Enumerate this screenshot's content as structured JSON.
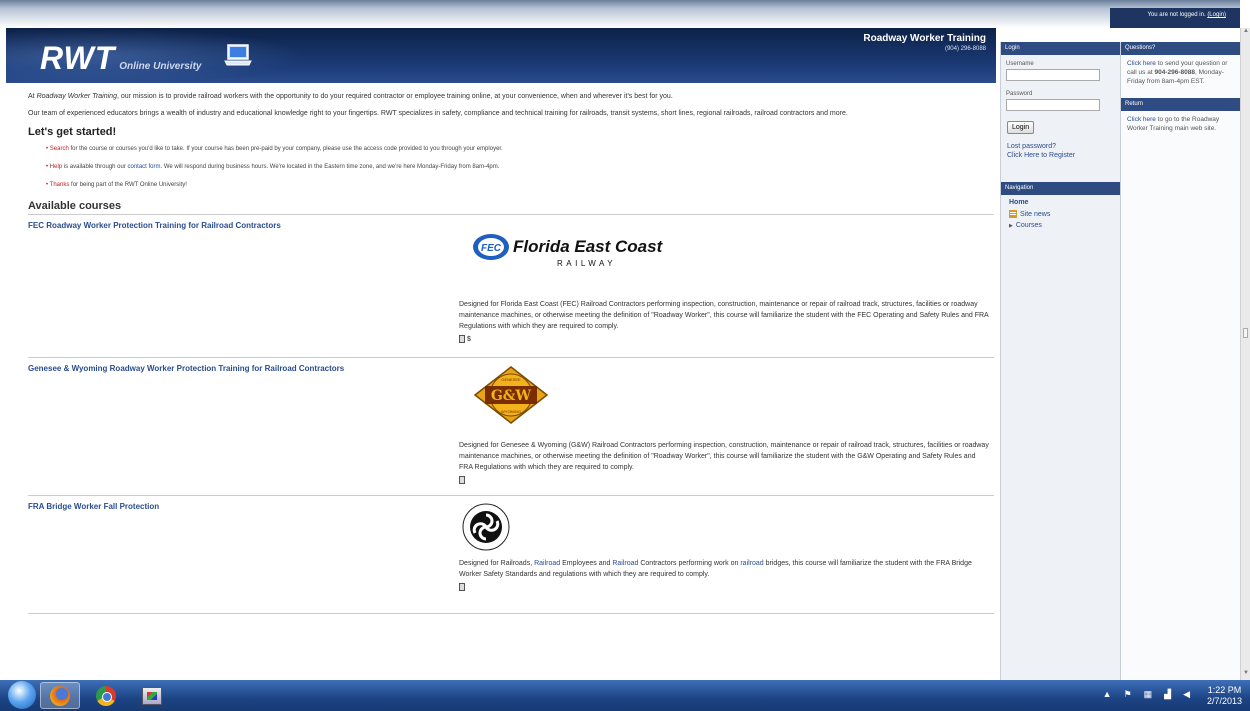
{
  "header": {
    "login_status": "You are not logged in.",
    "login_link": "(Login)",
    "logo_main": "RWT",
    "logo_sub": "Online University",
    "site_name": "Roadway Worker Training",
    "site_phone": "(904) 296-8088"
  },
  "intro": {
    "p1_prefix": "At ",
    "p1_company": "Roadway Worker Training",
    "p1_rest": ", our mission is to provide railroad workers with the opportunity to do your required contractor or employee training online, at your convenience, when and wherever it's best for you.",
    "p2": "Our team of experienced educators brings a wealth of industry and educational knowledge right to your fingertips. RWT specializes in safety, compliance and technical training for railroads, transit systems, short lines, regional railroads, railroad contractors and more."
  },
  "get_started": {
    "heading": "Let's get started!",
    "bullets": [
      {
        "kw": "Search",
        "text": " for the course or courses you'd like to take. If your course has been pre-paid by your company, please use the access code provided to you through your employer."
      },
      {
        "kw": "Help",
        "text_a": " is available through our ",
        "link": "contact form",
        "text_b": ". We will respond during business hours. We're located in the Eastern time zone, and we're here Monday-Friday from 8am-4pm."
      },
      {
        "kw": "Thanks",
        "text": " for being part of the RWT Online University!"
      }
    ]
  },
  "courses": {
    "heading": "Available courses",
    "items": [
      {
        "title": "FEC Roadway Worker Protection Training for Railroad Contractors",
        "logo_text_1": "Florida East Coast",
        "logo_text_2": "RAILWAY",
        "logo_badge": "FEC",
        "description": "Designed for Florida East Coast (FEC) Railroad Contractors performing inspection, construction, maintenance or repair of railroad track, structures, facilities or roadway maintenance machines, or otherwise meeting the definition of \"Roadway Worker\", this course will familiarize the student with the FEC Operating and Safety Rules and FRA Regulations with which they are required to comply.",
        "pay_icon": "$"
      },
      {
        "title": "Genesee & Wyoming Roadway Worker Protection Training for Railroad Contractors",
        "logo_text_1": "G&W",
        "logo_text_top": "GENESEE",
        "logo_text_bottom": "WYOMING",
        "description": "Designed for Genesee & Wyoming (G&W) Railroad Contractors performing inspection, construction, maintenance or repair of railroad track, structures, facilities or roadway maintenance machines, or otherwise meeting the definition of \"Roadway Worker\", this course will familiarize the student with the G&W Operating and Safety Rules and FRA Regulations with which they are required to comply."
      },
      {
        "title": "FRA Bridge Worker Fall Protection",
        "desc_a": "Designed for Railroads, ",
        "desc_link1": "Railroad",
        "desc_b": " Employees and ",
        "desc_link2": "Railroad",
        "desc_c": " Contractors performing work on ",
        "desc_link3": "railroad",
        "desc_d": " bridges, this course will familiarize the student with the FRA Bridge Worker Safety Standards and regulations with which they are required to comply."
      }
    ]
  },
  "login": {
    "heading": "Login",
    "username_label": "Username",
    "password_label": "Password",
    "button": "Login",
    "lost_password": "Lost password?",
    "register": "Click Here to Register"
  },
  "navigation": {
    "heading": "Navigation",
    "home": "Home",
    "site_news": "Site news",
    "courses": "Courses"
  },
  "questions": {
    "heading": "Questions?",
    "link": "Click here",
    "text_a": " to send your question or call us at ",
    "phone": "904-296-8088",
    "text_b": ", Monday-Friday from 8am-4pm EST."
  },
  "return": {
    "heading": "Return",
    "link": "Click here",
    "text": " to go to the Roadway Worker Training main web site."
  },
  "taskbar": {
    "time": "1:22 PM",
    "date": "2/7/2013"
  }
}
